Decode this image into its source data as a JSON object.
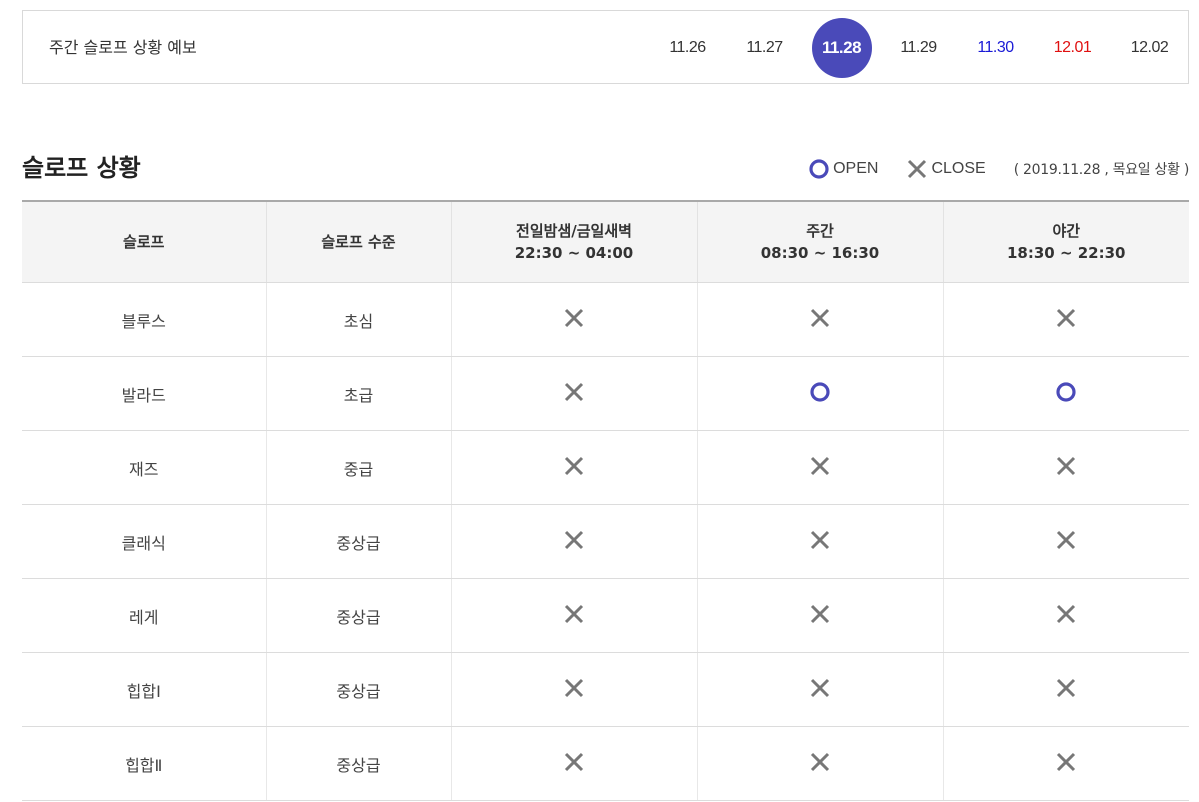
{
  "forecast": {
    "title": "주간 슬로프 상황 예보",
    "dates": [
      {
        "label": "11.26",
        "color": "#333333",
        "active": false
      },
      {
        "label": "11.27",
        "color": "#333333",
        "active": false
      },
      {
        "label": "11.28",
        "color": "#ffffff",
        "active": true
      },
      {
        "label": "11.29",
        "color": "#333333",
        "active": false
      },
      {
        "label": "11.30",
        "color": "#1a1ad6",
        "active": false
      },
      {
        "label": "12.01",
        "color": "#e01010",
        "active": false
      },
      {
        "label": "12.02",
        "color": "#333333",
        "active": false
      }
    ],
    "active_color": "#4a4ab9"
  },
  "section": {
    "title": "슬로프 상황"
  },
  "legend": {
    "open_label": "OPEN",
    "close_label": "CLOSE",
    "status_date": "( 2019.11.28 , 목요일 상황 )",
    "open_icon": "circle-icon",
    "close_icon": "x-icon",
    "open_color": "#4a4ab9",
    "close_color": "#777777"
  },
  "table": {
    "headers": [
      {
        "line1": "슬로프",
        "line2": ""
      },
      {
        "line1": "슬로프 수준",
        "line2": ""
      },
      {
        "line1": "전일밤샘/금일새벽",
        "line2": "22:30 ~ 04:00"
      },
      {
        "line1": "주간",
        "line2": "08:30 ~ 16:30"
      },
      {
        "line1": "야간",
        "line2": "18:30 ~ 22:30"
      }
    ],
    "rows": [
      {
        "slope": "블루스",
        "level": "초심",
        "status": [
          "close",
          "close",
          "close"
        ]
      },
      {
        "slope": "발라드",
        "level": "초급",
        "status": [
          "close",
          "open",
          "open"
        ]
      },
      {
        "slope": "재즈",
        "level": "중급",
        "status": [
          "close",
          "close",
          "close"
        ]
      },
      {
        "slope": "클래식",
        "level": "중상급",
        "status": [
          "close",
          "close",
          "close"
        ]
      },
      {
        "slope": "레게",
        "level": "중상급",
        "status": [
          "close",
          "close",
          "close"
        ]
      },
      {
        "slope": "힙합Ⅰ",
        "level": "중상급",
        "status": [
          "close",
          "close",
          "close"
        ]
      },
      {
        "slope": "힙합Ⅱ",
        "level": "중상급",
        "status": [
          "close",
          "close",
          "close"
        ]
      }
    ]
  }
}
